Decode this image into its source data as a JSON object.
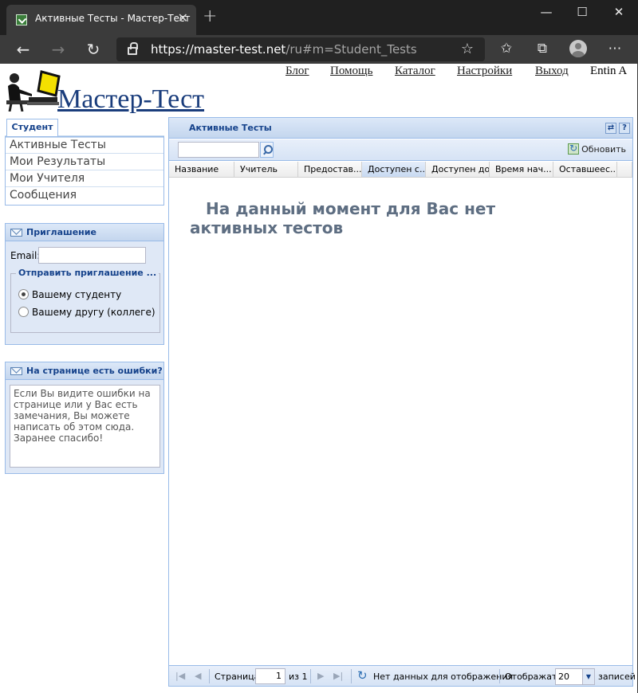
{
  "browser": {
    "tab_title": "Активные Тесты - Мастер-Тест",
    "url_host": "https://master-test.net",
    "url_path": "/ru#m=Student_Tests"
  },
  "header": {
    "logo_text": "Мастер-Тест",
    "nav": [
      "Блог",
      "Помощь",
      "Каталог",
      "Настройки",
      "Выход"
    ],
    "user": "Entin A"
  },
  "student": {
    "tab_label": "Студент",
    "menu": [
      "Активные Тесты",
      "Мои Результаты",
      "Мои Учителя",
      "Сообщения"
    ]
  },
  "invite": {
    "title": "Приглашение",
    "email_label": "Email:",
    "email_value": "",
    "send_legend": "Отправить приглашение ...",
    "options": [
      {
        "label": "Вашему студенту",
        "selected": true
      },
      {
        "label": "Вашему другу (коллеге)",
        "selected": false
      }
    ]
  },
  "feedback": {
    "title": "На странице есть ошибки?",
    "text": "Если Вы видите ошибки на странице или у Вас есть замечания, Вы можете написать об этом сюда.\nЗаранее спасибо!"
  },
  "grid": {
    "title": "Активные Тесты",
    "search_value": "",
    "refresh_label": "Обновить",
    "columns": [
      "Название",
      "Учитель",
      "Предостав...",
      "Доступен с...",
      "Доступен до",
      "Время нач...",
      "Оставшеес..."
    ],
    "sorted_column": "Доступен с...",
    "empty_message": "На данный момент для Вас нет активных тестов",
    "footer": {
      "page_label": "Страница",
      "page_value": "1",
      "of_label": "из 1",
      "no_data": "Нет данных для отображения",
      "show_label": "Отображать",
      "page_size": "20",
      "records_label": "записей"
    }
  },
  "colors": {
    "panel_border": "#99bbe8",
    "panel_title": "#15428b",
    "logo": "#1a3d7c"
  }
}
